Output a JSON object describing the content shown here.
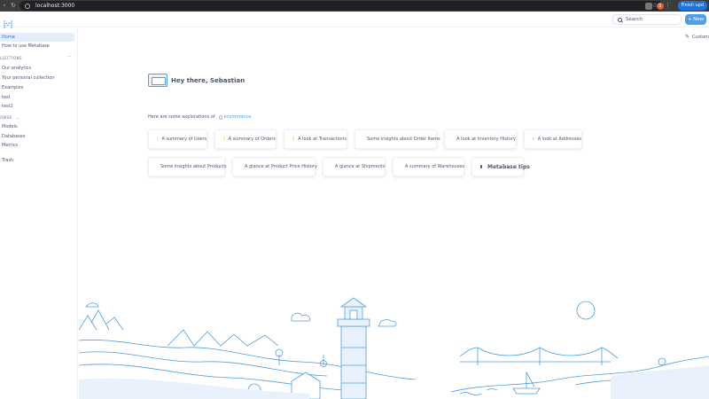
{
  "browser": {
    "url": "localhost:3000",
    "finish_label": "Finish upd",
    "profile_initial": "S"
  },
  "header": {
    "search_placeholder": "Search",
    "new_label": "+ New"
  },
  "sidebar": {
    "home": "Home",
    "how_to": "How to use Metabase",
    "collections_heading": "LLECTIONS",
    "collections": [
      "Our analytics",
      "Your personal collection",
      "Examples",
      "test",
      "test2"
    ],
    "browse_heading": "OWSE",
    "browse": [
      "Models",
      "Databases",
      "Metrics"
    ],
    "trash": "Trash"
  },
  "main": {
    "customize_label": "Custom",
    "greeting": "Hey there, Sebastian",
    "explore_prefix": "Here are some explorations of",
    "explore_db": "ecommence",
    "cards_row1": [
      {
        "prefix": "A summary of ",
        "target": "Users"
      },
      {
        "prefix": "A summary of ",
        "target": "Orders"
      },
      {
        "prefix": "A look at ",
        "target": "Transactions"
      },
      {
        "prefix": "Some insights about ",
        "target": "Order Items"
      },
      {
        "prefix": "A look at ",
        "target": "Inventory History"
      },
      {
        "prefix": "A look at ",
        "target": "Addresses"
      }
    ],
    "cards_row2": [
      {
        "prefix": "Some insights about ",
        "target": "Products"
      },
      {
        "prefix": "A glance at ",
        "target": "Product Price History"
      },
      {
        "prefix": "A glance at ",
        "target": "Shipments"
      },
      {
        "prefix": "A summary of ",
        "target": "Warehouses"
      }
    ],
    "tips_label": "Metabase tips"
  },
  "colors": {
    "brand": "#509ee3",
    "text": "#4c5773",
    "active_bg": "#e4eefa",
    "illustration": "#509ee3"
  }
}
